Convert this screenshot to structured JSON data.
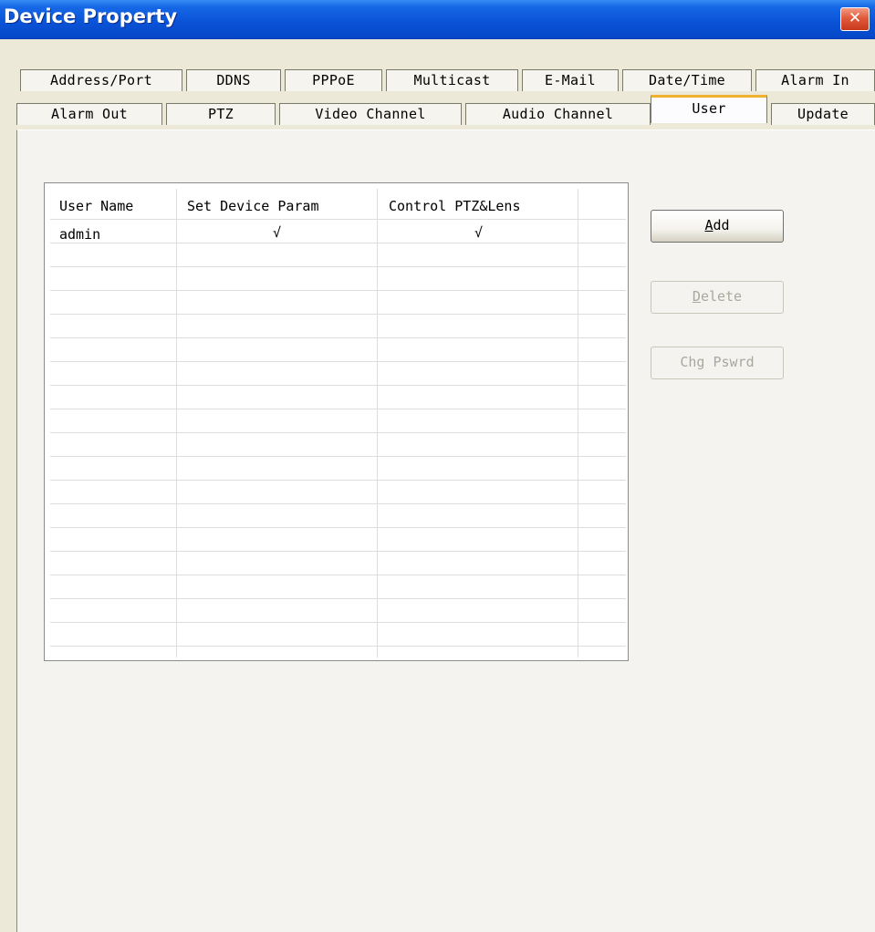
{
  "window": {
    "title": "Device Property",
    "close_glyph": "✕"
  },
  "tabs_row1": [
    {
      "label": "Address/Port"
    },
    {
      "label": "DDNS"
    },
    {
      "label": "PPPoE"
    },
    {
      "label": "Multicast"
    },
    {
      "label": "E-Mail"
    },
    {
      "label": "Date/Time"
    },
    {
      "label": "Alarm In"
    }
  ],
  "tabs_row2": [
    {
      "label": "Alarm Out"
    },
    {
      "label": "PTZ"
    },
    {
      "label": "Video Channel"
    },
    {
      "label": "Audio Channel"
    },
    {
      "label": "User",
      "active": true
    },
    {
      "label": "Update"
    }
  ],
  "user_table": {
    "columns": [
      "User Name",
      "Set Device Param",
      "Control PTZ&Lens"
    ],
    "rows": [
      {
        "user_name": "admin",
        "set_device_param": "√",
        "control_ptz_lens": "√"
      }
    ]
  },
  "buttons": {
    "add": {
      "mnemonic": "A",
      "rest": "dd"
    },
    "delete": {
      "mnemonic": "D",
      "rest": "elete"
    },
    "change_password": "Chg Pswrd"
  },
  "colors": {
    "title_bar": "#0a54d8",
    "active_tab_highlight": "#f0b030",
    "close_button": "#e05a3a"
  }
}
